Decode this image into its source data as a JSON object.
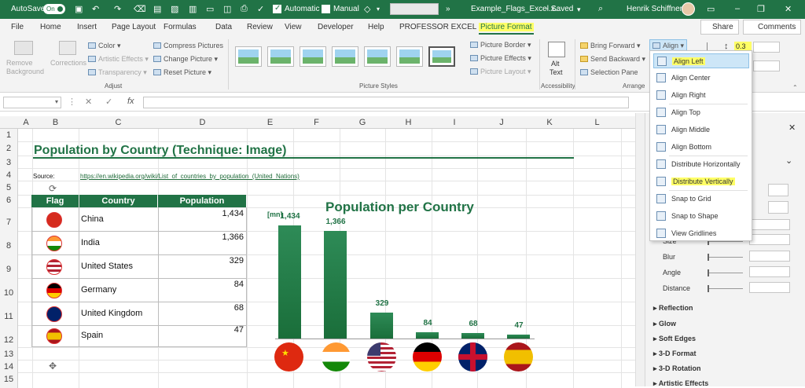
{
  "titlebar": {
    "autosave": "AutoSave",
    "toggle": "On",
    "automatic": "Automatic",
    "manual": "Manual",
    "filename": "Example_Flags_Excel.x...",
    "saved": "Saved",
    "user": "Henrik Schiffner",
    "more": "»"
  },
  "tabs": [
    "File",
    "Home",
    "Insert",
    "Page Layout",
    "Formulas",
    "Data",
    "Review",
    "View",
    "Developer",
    "Help",
    "PROFESSOR EXCEL",
    "Picture Format"
  ],
  "share": "Share",
  "comments": "Comments",
  "ribbon": {
    "remove_background": [
      "Remove",
      "Background"
    ],
    "corrections": "Corrections",
    "color": "Color",
    "artistic_effects": "Artistic Effects",
    "transparency": "Transparency",
    "compress": "Compress Pictures",
    "change": "Change Picture",
    "reset": "Reset Picture",
    "adjust": "Adjust",
    "picture_styles": "Picture Styles",
    "border": "Picture Border",
    "effects": "Picture Effects",
    "layout": "Picture Layout",
    "alt_text": [
      "Alt",
      "Text"
    ],
    "accessibility": "Accessibility",
    "bring_forward": "Bring Forward",
    "send_backward": "Send Backward",
    "selection_pane": "Selection Pane",
    "arrange": "Arrange",
    "align": "Align",
    "size_value": "0.3"
  },
  "align_menu": [
    {
      "label": "Align Left",
      "highlight": true
    },
    {
      "label": "Align Center"
    },
    {
      "label": "Align Right"
    },
    {
      "label": "Align Top"
    },
    {
      "label": "Align Middle"
    },
    {
      "label": "Align Bottom"
    },
    {
      "label": "Distribute Horizontally"
    },
    {
      "label": "Distribute Vertically",
      "highlight": true
    },
    {
      "label": "Snap to Grid"
    },
    {
      "label": "Snap to Shape"
    },
    {
      "label": "View Gridlines"
    }
  ],
  "columns": [
    "A",
    "B",
    "C",
    "D",
    "E",
    "F",
    "G",
    "H",
    "I",
    "J",
    "K",
    "L"
  ],
  "rows": [
    "1",
    "2",
    "3",
    "4",
    "5",
    "6",
    "7",
    "8",
    "9",
    "10",
    "11",
    "12",
    "13",
    "14",
    "15"
  ],
  "sheet": {
    "title": "Population by Country (Technique: Image)",
    "source_label": "Source:",
    "source_url": "https://en.wikipedia.org/wiki/List_of_countries_by_population_(United_Nations)",
    "headers": [
      "Flag",
      "Country",
      "Population"
    ],
    "table": [
      {
        "country": "China",
        "population": "1,434"
      },
      {
        "country": "India",
        "population": "1,366"
      },
      {
        "country": "United States",
        "population": "329"
      },
      {
        "country": "Germany",
        "population": "84"
      },
      {
        "country": "United Kingdom",
        "population": "68"
      },
      {
        "country": "Spain",
        "population": "47"
      }
    ]
  },
  "chart_data": {
    "type": "bar",
    "title": "Population per Country",
    "ylabel": "[mn]",
    "categories": [
      "China",
      "India",
      "United States",
      "Germany",
      "United Kingdom",
      "Spain"
    ],
    "values": [
      1434,
      1366,
      329,
      84,
      68,
      47
    ],
    "labels": [
      "1,434",
      "1,366",
      "329",
      "84",
      "68",
      "47"
    ],
    "ylim": [
      0,
      1434
    ],
    "bar_color": "#217346",
    "grid": false
  },
  "pane": {
    "items": [
      "Size",
      "Blur",
      "Angle",
      "Distance"
    ],
    "sections": [
      "Reflection",
      "Glow",
      "Soft Edges",
      "3-D Format",
      "3-D Rotation",
      "Artistic Effects"
    ]
  }
}
